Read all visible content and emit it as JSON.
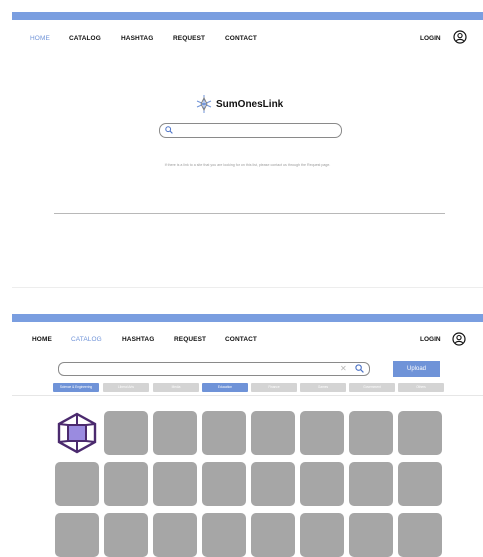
{
  "home": {
    "nav": {
      "items": [
        {
          "label": "HOME",
          "active": true
        },
        {
          "label": "CATALOG",
          "active": false
        },
        {
          "label": "HASHTAG",
          "active": false
        },
        {
          "label": "REQUEST",
          "active": false
        },
        {
          "label": "CONTACT",
          "active": false
        }
      ],
      "login_label": "LOGIN",
      "avatar_icon": "user-circle-icon"
    },
    "brand": {
      "name": "SumOnesLink",
      "logo_icon": "star-link-logo"
    },
    "search": {
      "placeholder": "",
      "icon": "search-icon"
    },
    "hint": "If there is a link to a site that you are looking for on this list, please contact us through the Request page.",
    "colors": {
      "accent": "#6f93d8",
      "topbar": "#7a9ee0"
    }
  },
  "catalog": {
    "nav": {
      "items": [
        {
          "label": "HOME",
          "active": false
        },
        {
          "label": "CATALOG",
          "active": true
        },
        {
          "label": "HASHTAG",
          "active": false
        },
        {
          "label": "REQUEST",
          "active": false
        },
        {
          "label": "CONTACT",
          "active": false
        }
      ],
      "login_label": "LOGIN",
      "avatar_icon": "user-circle-icon"
    },
    "search": {
      "placeholder": "",
      "clear_icon": "close-icon",
      "search_icon": "search-icon"
    },
    "upload_label": "Upload",
    "category_tabs": [
      {
        "label": "Science & Engineering",
        "selected": true
      },
      {
        "label": "Liberal Arts",
        "selected": false
      },
      {
        "label": "Media",
        "selected": false
      },
      {
        "label": "Education",
        "selected": true
      },
      {
        "label": "Finance",
        "selected": false
      },
      {
        "label": "Games",
        "selected": false
      },
      {
        "label": "Government",
        "selected": false
      },
      {
        "label": "Others",
        "selected": false
      }
    ],
    "first_tile_icon": "cube-logo-icon",
    "tile_rows": 3,
    "tile_cols": 8
  }
}
